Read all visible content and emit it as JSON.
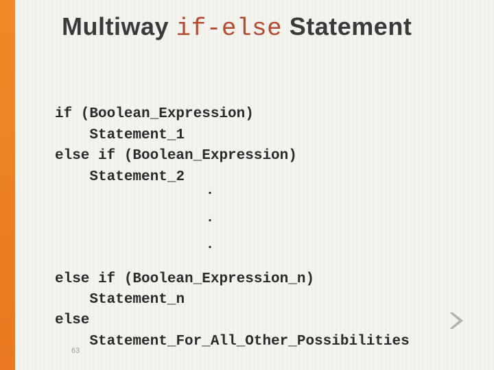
{
  "title": {
    "pre": "Multiway ",
    "mono": "if-else",
    "post": " Statement"
  },
  "code": {
    "l1": "if (Boolean_Expression)",
    "l2": "Statement_1",
    "l3": "else if (Boolean_Expression)",
    "l4": "Statement_2",
    "dot1": ".",
    "dot2": ".",
    "dot3": ".",
    "l5": "else if (Boolean_Expression_n)",
    "l6": "Statement_n",
    "l7": "else",
    "l8": "Statement_For_All_Other_Possibilities"
  },
  "page_number": "63"
}
